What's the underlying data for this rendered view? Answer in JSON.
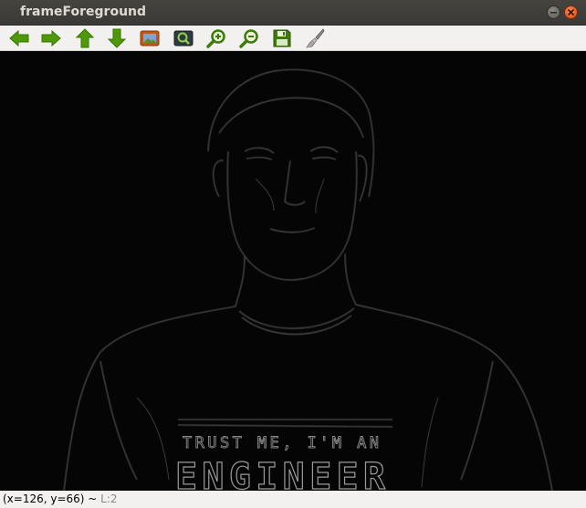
{
  "window": {
    "title": "frameForeground"
  },
  "toolbar": {
    "buttons": [
      {
        "name": "pan-left",
        "icon": "arrow-left-icon",
        "color": "#4e9a06"
      },
      {
        "name": "pan-right",
        "icon": "arrow-right-icon",
        "color": "#4e9a06"
      },
      {
        "name": "pan-up",
        "icon": "arrow-up-icon",
        "color": "#4e9a06"
      },
      {
        "name": "pan-down",
        "icon": "arrow-down-icon",
        "color": "#4e9a06"
      },
      {
        "name": "zoom-original",
        "icon": "image-icon"
      },
      {
        "name": "zoom-fit",
        "icon": "zoom-fit-icon"
      },
      {
        "name": "zoom-in",
        "icon": "zoom-in-icon"
      },
      {
        "name": "zoom-out",
        "icon": "zoom-out-icon"
      },
      {
        "name": "save",
        "icon": "floppy-disk-icon"
      },
      {
        "name": "properties",
        "icon": "brush-icon"
      }
    ]
  },
  "canvas": {
    "shirt_text_line1": "TRUST ME, I'M AN",
    "shirt_text_line2": "ENGINEER"
  },
  "status": {
    "coords": "(x=126, y=66) ~ ",
    "level": "L:2"
  }
}
